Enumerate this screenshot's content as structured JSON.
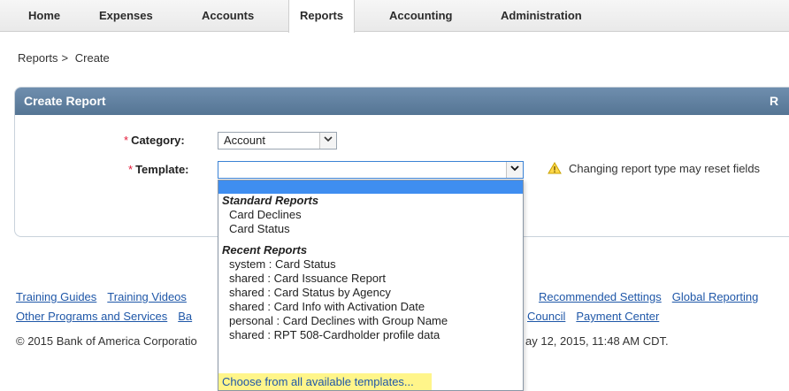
{
  "nav": {
    "tabs": [
      {
        "label": "Home"
      },
      {
        "label": "Expenses"
      },
      {
        "label": "Accounts"
      },
      {
        "label": "Reports"
      },
      {
        "label": "Accounting"
      },
      {
        "label": "Administration"
      }
    ],
    "active": "Reports"
  },
  "breadcrumb": {
    "parent": "Reports",
    "separator": ">",
    "current": "Create"
  },
  "panel": {
    "title": "Create Report",
    "header_right": "R"
  },
  "form": {
    "required_marker": "*",
    "category_label": "Category:",
    "category_value": "Account",
    "template_label": "Template:",
    "template_value": "",
    "warning_text": "Changing report type may reset fields"
  },
  "dropdown": {
    "groups": [
      {
        "name": "Standard Reports",
        "options": [
          "Card Declines",
          "Card Status"
        ]
      },
      {
        "name": "Recent Reports",
        "options": [
          "system : Card Status",
          "shared : Card Issuance Report",
          "shared : Card Status by Agency",
          "shared : Card Info with Activation Date",
          "personal : Card Declines with Group Name",
          "shared : RPT 508-Cardholder profile data"
        ]
      }
    ],
    "choose_all": "Choose from all available templates..."
  },
  "footer": {
    "row1": [
      "Training Guides",
      "Training Videos"
    ],
    "row1_right": [
      "Recommended Settings",
      "Global Reporting"
    ],
    "row2_left": [
      "Other Programs and Services",
      "Ba"
    ],
    "row2_right": [
      "Council",
      "Payment Center"
    ],
    "copyright_left": "© 2015 Bank of America Corporatio",
    "copyright_right": "ay 12, 2015, 11:48 AM CDT."
  },
  "colors": {
    "accent_red": "#e31837",
    "header_blue": "#557594",
    "link_blue": "#1f57a8",
    "highlight_yellow": "#fff58a",
    "selection_blue": "#3f8ef0"
  },
  "icons": {
    "select_arrow": "chevron-down-icon",
    "warning": "warning-icon"
  }
}
